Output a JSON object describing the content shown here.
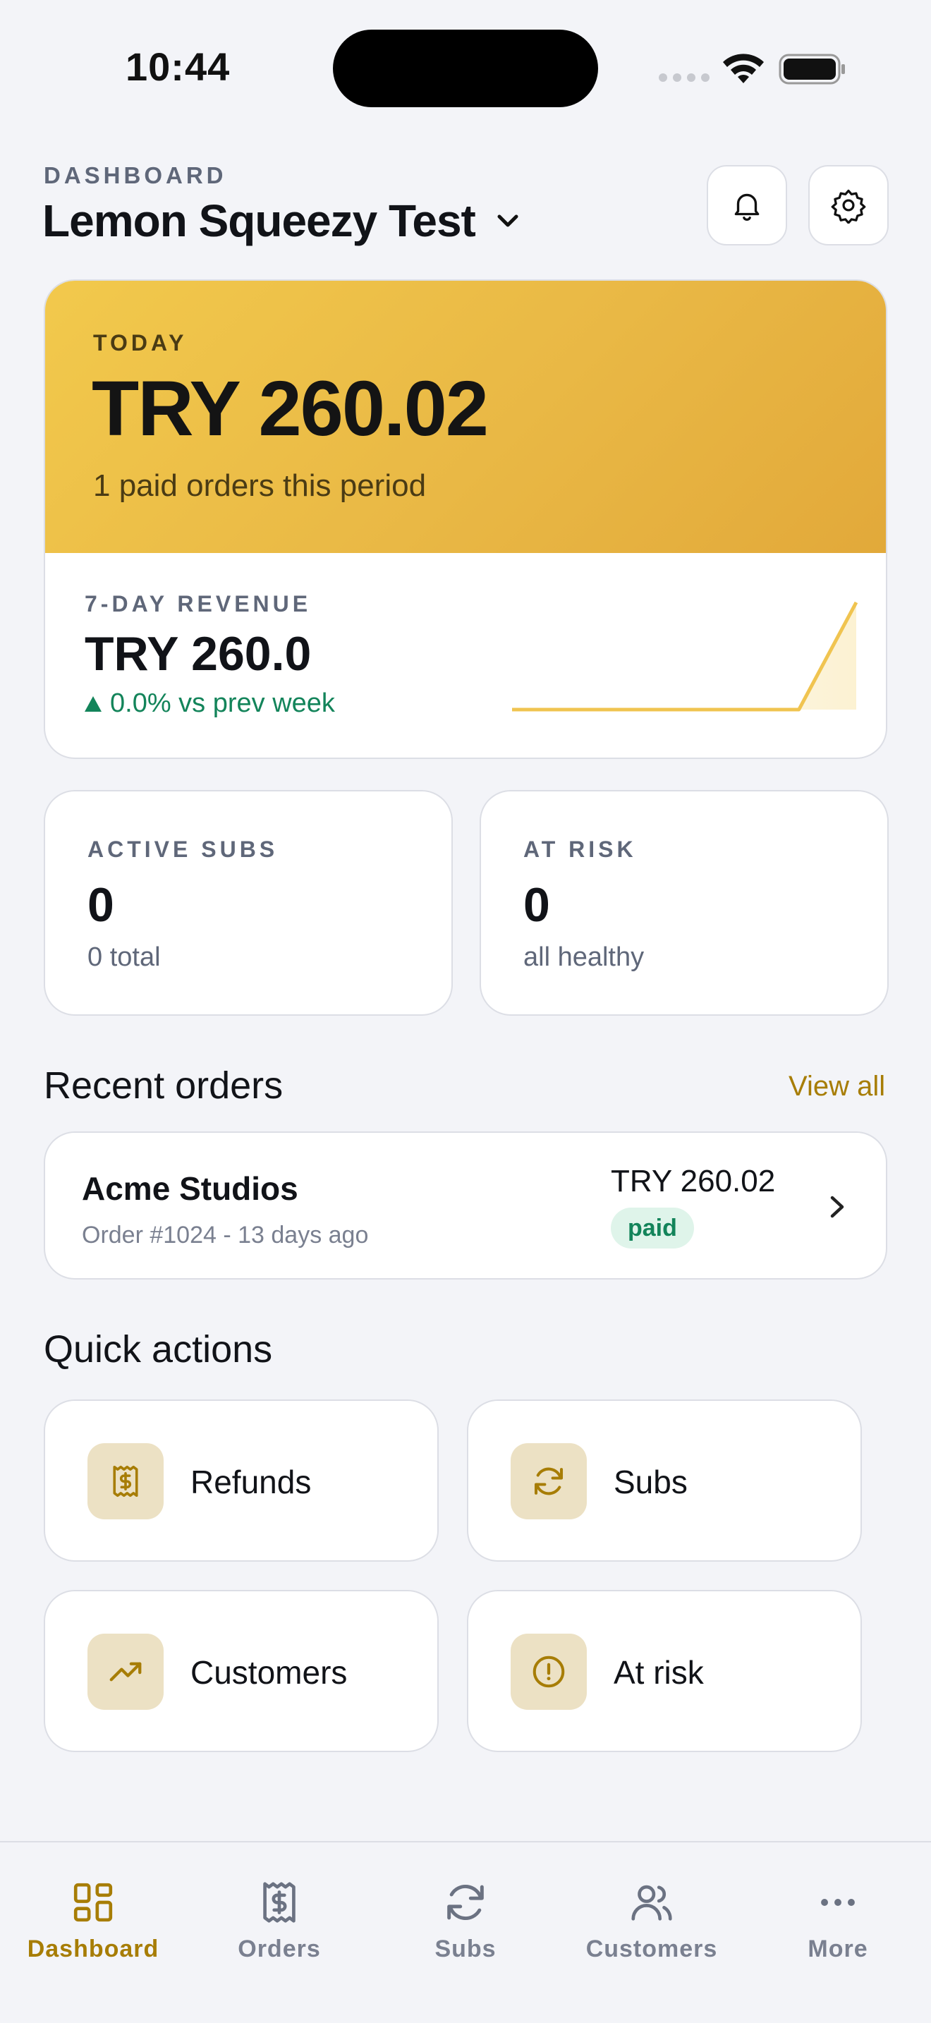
{
  "status_bar": {
    "time": "10:44"
  },
  "header": {
    "eyebrow": "DASHBOARD",
    "store_name": "Lemon Squeezy Test",
    "icons": [
      "bell-icon",
      "gear-icon",
      "chevron-down-icon"
    ]
  },
  "hero": {
    "eyebrow": "TODAY",
    "value": "TRY 260.02",
    "subtitle": "1 paid orders this period",
    "revenue_eyebrow": "7-DAY REVENUE",
    "revenue_value": "TRY 260.0",
    "revenue_delta": "0.0% vs prev week"
  },
  "chart_data": {
    "type": "line",
    "series": [
      {
        "values": [
          0,
          0,
          0,
          0,
          0,
          0,
          260.0
        ]
      }
    ],
    "color": "#f0c450"
  },
  "stats": [
    {
      "label": "ACTIVE SUBS",
      "value": "0",
      "sub": "0 total"
    },
    {
      "label": "AT RISK",
      "value": "0",
      "sub": "all healthy"
    }
  ],
  "recent_orders": {
    "title": "Recent orders",
    "view_all": "View all",
    "items": [
      {
        "name": "Acme Studios",
        "meta": "Order #1024 - 13 days ago",
        "amount": "TRY 260.02",
        "status": "paid"
      }
    ]
  },
  "quick_actions": {
    "title": "Quick actions",
    "items": [
      {
        "label": "Refunds",
        "icon": "receipt-dollar-icon"
      },
      {
        "label": "Subs",
        "icon": "refresh-icon"
      },
      {
        "label": "Customers",
        "icon": "trending-up-icon"
      },
      {
        "label": "At risk",
        "icon": "alert-circle-icon"
      }
    ]
  },
  "tabbar": {
    "active": "Dashboard",
    "items": [
      {
        "label": "Dashboard",
        "icon": "grid-icon"
      },
      {
        "label": "Orders",
        "icon": "receipt-dollar-icon"
      },
      {
        "label": "Subs",
        "icon": "refresh-icon"
      },
      {
        "label": "Customers",
        "icon": "users-icon"
      },
      {
        "label": "More",
        "icon": "more-icon"
      }
    ]
  },
  "colors": {
    "accent": "#a77d06",
    "hero_gradient_start": "#f2c94c",
    "hero_gradient_end": "#e2a93a",
    "positive": "#13845a",
    "background": "#f3f4f8"
  }
}
